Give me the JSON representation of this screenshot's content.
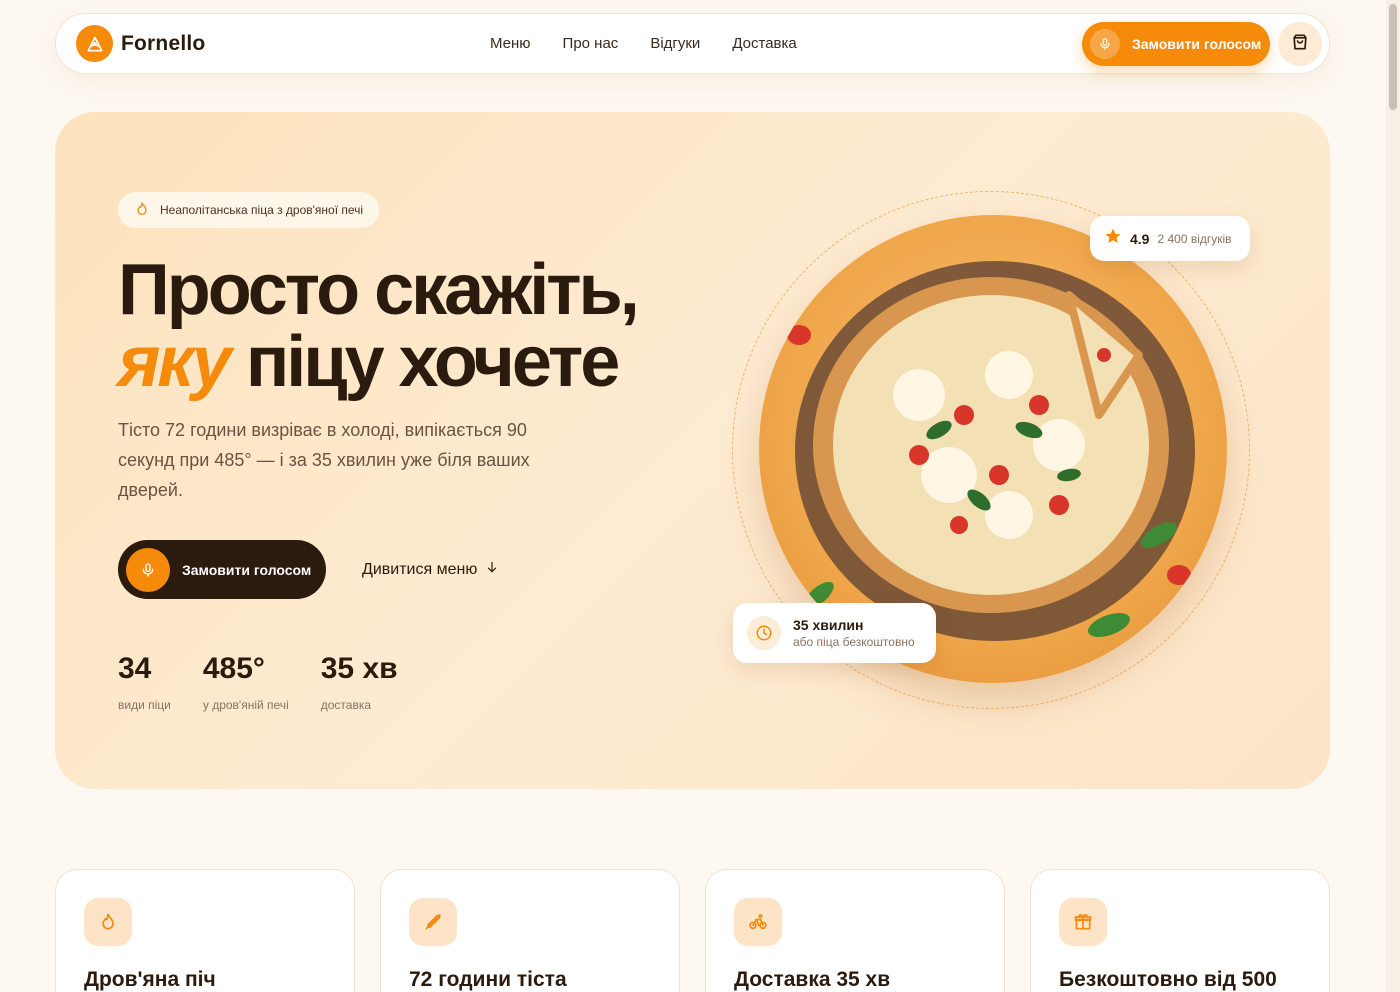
{
  "header": {
    "brand": "Fornello",
    "nav": [
      "Меню",
      "Про нас",
      "Відгуки",
      "Доставка"
    ],
    "voice_button": "Замовити голосом"
  },
  "hero": {
    "badge": "Неаполітанська піца з дров'яної печі",
    "title_line1": "Просто скажіть,",
    "title_accent": "яку",
    "title_line2_rest": " піцу хочете",
    "lead": "Тісто 72 години визріває в холоді, випікається 90 секунд при 485° — і за 35 хвилин уже біля ваших дверей.",
    "cta": "Замовити голосом",
    "menu_link": "Дивитися меню",
    "stats": [
      {
        "value": "34",
        "label": "види піци"
      },
      {
        "value": "485°",
        "label": "у дров'яній печі"
      },
      {
        "value": "35 хв",
        "label": "доставка"
      }
    ],
    "rating": {
      "value": "4.9",
      "count": "2 400 відгуків"
    },
    "time_card": {
      "title": "35 хвилин",
      "subtitle": "або піца безкоштовно"
    }
  },
  "features": [
    {
      "icon": "flame-icon",
      "title": "Дров'яна піч"
    },
    {
      "icon": "wheat-icon",
      "title": "72 години тіста"
    },
    {
      "icon": "bike-icon",
      "title": "Доставка 35 хв"
    },
    {
      "icon": "gift-icon",
      "title": "Безкоштовно від 500"
    }
  ],
  "colors": {
    "accent": "#f58a0b",
    "dark": "#2b1a0e",
    "hero_bg": "#fde3bd"
  }
}
